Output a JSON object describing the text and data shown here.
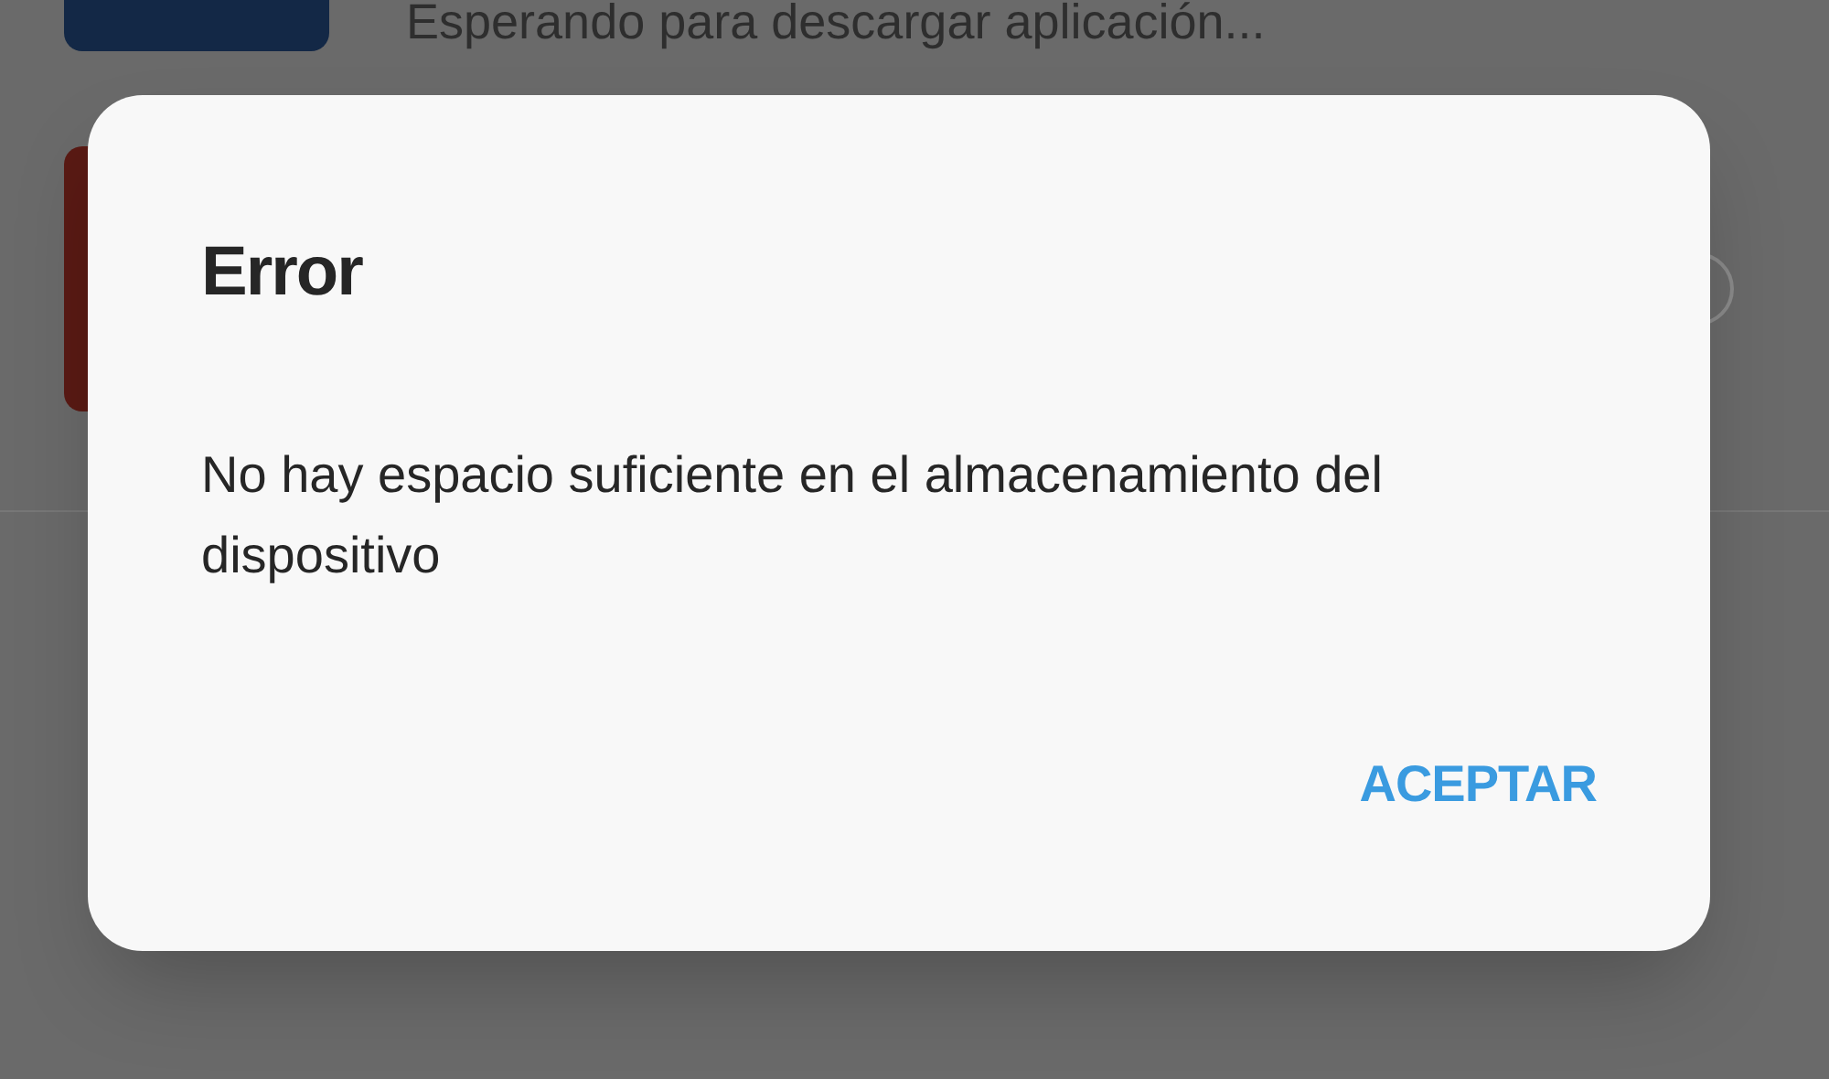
{
  "background_list": {
    "status_text": "Esperando para descargar aplicación..."
  },
  "dialog": {
    "title": "Error",
    "message": "No hay espacio suficiente en el almacenamiento del dispositivo",
    "buttons": [
      "ACEPTAR"
    ]
  }
}
